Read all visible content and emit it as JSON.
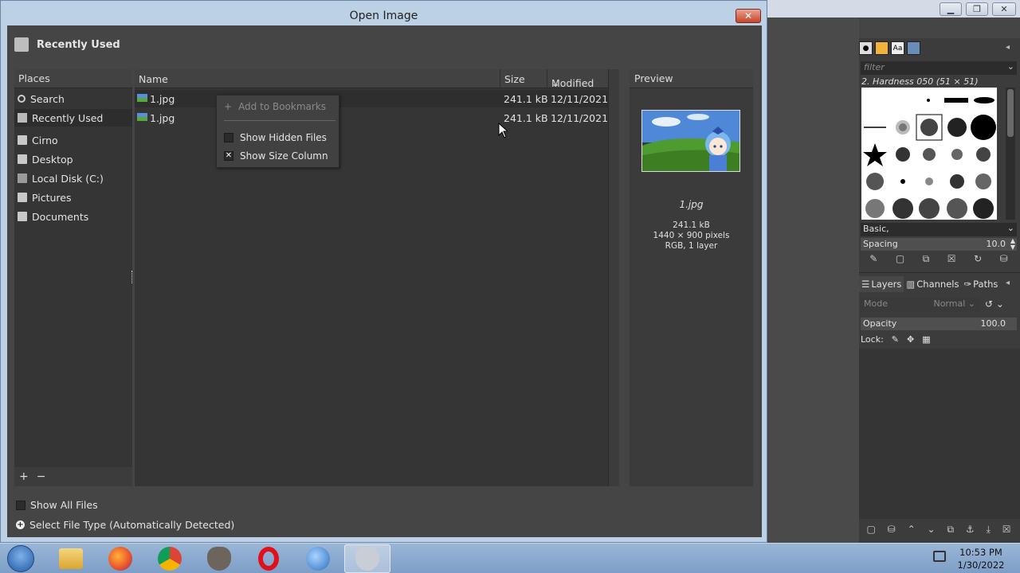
{
  "dialog": {
    "title": "Open Image",
    "close_label": "✕",
    "path_label": "Recently Used"
  },
  "places": {
    "header": "Places",
    "items": [
      {
        "label": "Search",
        "icon": "search-icon"
      },
      {
        "label": "Recently Used",
        "icon": "recent-icon",
        "selected": true
      },
      {
        "label": "Cirno",
        "icon": "folder-icon"
      },
      {
        "label": "Desktop",
        "icon": "folder-icon"
      },
      {
        "label": "Local Disk (C:)",
        "icon": "disk-icon"
      },
      {
        "label": "Pictures",
        "icon": "folder-icon"
      },
      {
        "label": "Documents",
        "icon": "folder-icon"
      }
    ],
    "add_label": "+",
    "remove_label": "−"
  },
  "files": {
    "columns": {
      "name": "Name",
      "size": "Size",
      "modified": "Modified"
    },
    "sort_indicator": "⌄",
    "rows": [
      {
        "name": "1.jpg",
        "size": "241.1 kB",
        "modified": "12/11/2021"
      },
      {
        "name": "1.jpg",
        "size": "241.1 kB",
        "modified": "12/11/2021"
      }
    ]
  },
  "context_menu": {
    "items": [
      {
        "label": "Add to Bookmarks",
        "icon": "plus-icon",
        "disabled": true
      },
      {
        "label": "Show Hidden Files",
        "checked": false
      },
      {
        "label": "Show Size Column",
        "checked": true
      }
    ]
  },
  "preview": {
    "header": "Preview",
    "filename": "1.jpg",
    "size": "241.1 kB",
    "dimensions": "1440 × 900 pixels",
    "mode": "RGB, 1 layer"
  },
  "options": {
    "show_all_files": "Show All Files",
    "select_file_type": "Select File Type (Automatically Detected)"
  },
  "gimp_dock": {
    "filter_placeholder": "filter",
    "brush_name": "2. Hardness 050 (51 × 51)",
    "brush_tag": "Basic,",
    "spacing_label": "Spacing",
    "spacing_value": "10.0",
    "tabs": {
      "layers": "Layers",
      "channels": "Channels",
      "paths": "Paths"
    },
    "mode_label": "Mode",
    "mode_value": "Normal",
    "opacity_label": "Opacity",
    "opacity_value": "100.0",
    "lock_label": "Lock:"
  },
  "taskbar": {
    "apps": [
      "file-explorer-icon",
      "firefox-icon",
      "chrome-icon",
      "gimp-icon",
      "opera-icon",
      "thunderbird-icon",
      "gimp-window-icon"
    ],
    "time": "10:53 PM",
    "date": "1/30/2022"
  },
  "colors": {
    "dialog_bg": "#454545",
    "pane_bg": "#353535",
    "titlebar": "#bcd0e6",
    "close_red": "#c8452b"
  }
}
